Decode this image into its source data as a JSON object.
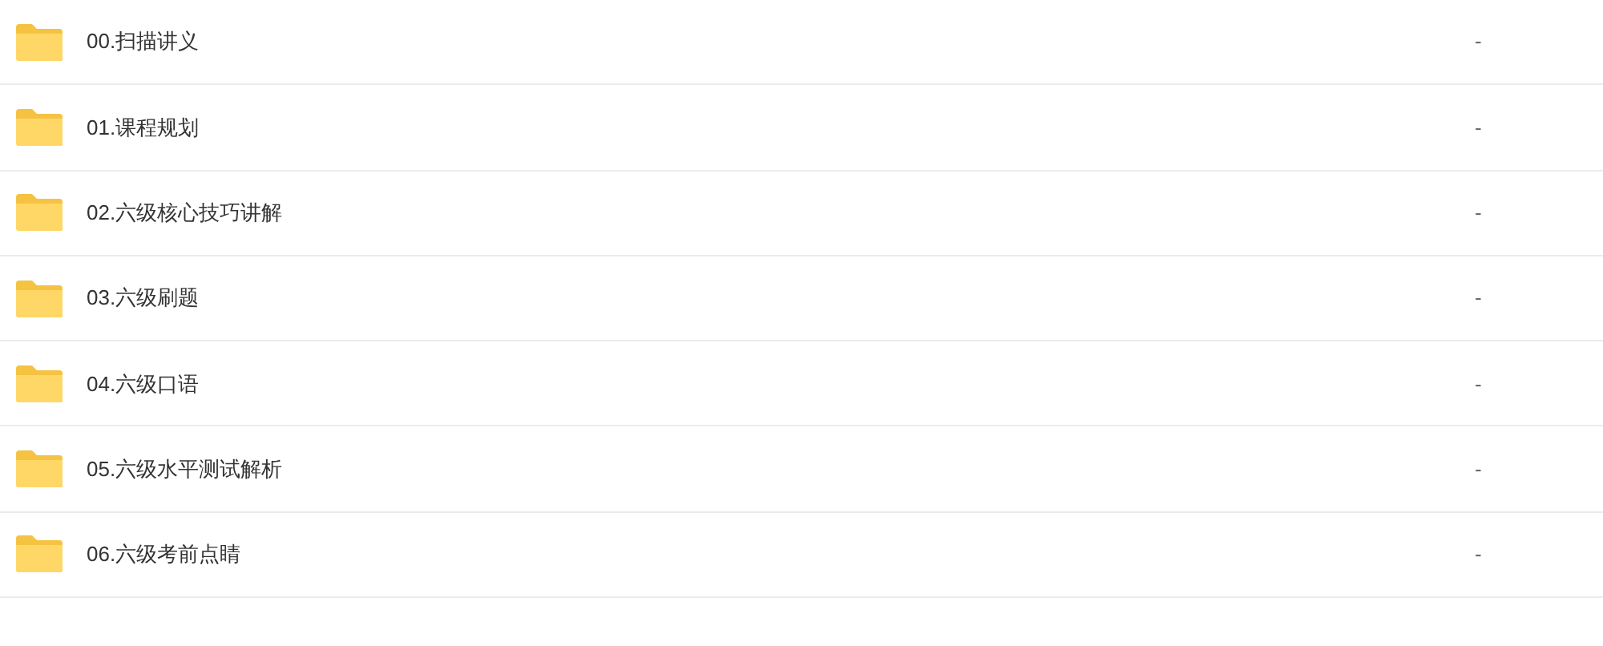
{
  "files": [
    {
      "name": "00.扫描讲义",
      "size": "-"
    },
    {
      "name": "01.课程规划",
      "size": "-"
    },
    {
      "name": "02.六级核心技巧讲解",
      "size": "-"
    },
    {
      "name": "03.六级刷题",
      "size": "-"
    },
    {
      "name": "04.六级口语",
      "size": "-"
    },
    {
      "name": "05.六级水平测试解析",
      "size": "-"
    },
    {
      "name": "06.六级考前点睛",
      "size": "-"
    }
  ]
}
